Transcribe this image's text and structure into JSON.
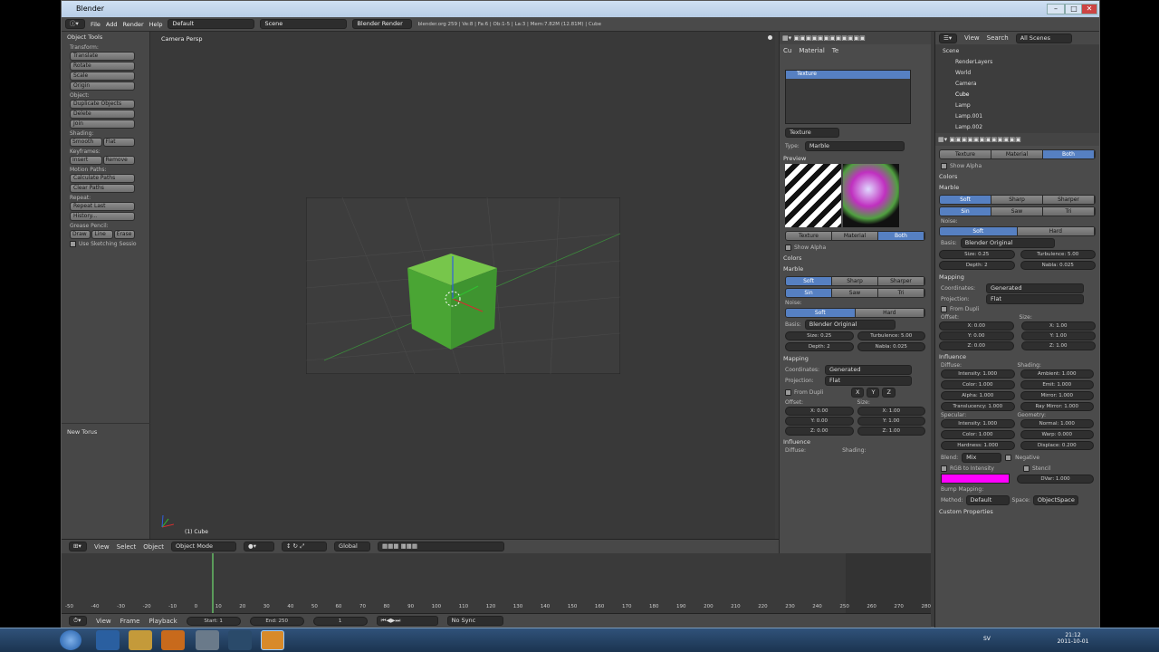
{
  "window": {
    "title": "Blender"
  },
  "menu": {
    "items": [
      "File",
      "Add",
      "Render",
      "Help"
    ],
    "layout": "Default",
    "scene": "Scene",
    "engine": "Blender Render",
    "stats": "blender.org 259 | Ve:8 | Fa:6 | Ob:1-5 | La:3 | Mem:7.82M (12.81M) | Cube"
  },
  "tools": {
    "header": "Object Tools",
    "transform_label": "Transform:",
    "transform": [
      "Translate",
      "Rotate",
      "Scale",
      "Origin"
    ],
    "object_label": "Object:",
    "object": [
      "Duplicate Objects",
      "Delete",
      "Join"
    ],
    "shading_label": "Shading:",
    "shading": [
      "Smooth",
      "Flat"
    ],
    "keyframes_label": "Keyframes:",
    "keyframes": [
      "Insert",
      "Remove"
    ],
    "motion_label": "Motion Paths:",
    "motion": [
      "Calculate Paths",
      "Clear Paths"
    ],
    "repeat_label": "Repeat:",
    "repeat": [
      "Repeat Last",
      "History..."
    ],
    "grease_label": "Grease Pencil:",
    "grease": [
      "Draw",
      "Line",
      "Erase"
    ],
    "sketch": "Use Sketching Sessio",
    "new_torus": "New Torus"
  },
  "viewport": {
    "label": "Camera Persp",
    "object_label": "(1) Cube"
  },
  "vheader": {
    "view": "View",
    "select": "Select",
    "object": "Object",
    "mode": "Object Mode",
    "orient": "Global"
  },
  "timeline": {
    "ticks": [
      "-50",
      "-40",
      "-30",
      "-20",
      "-10",
      "0",
      "10",
      "20",
      "30",
      "40",
      "50",
      "60",
      "70",
      "80",
      "90",
      "100",
      "110",
      "120",
      "130",
      "140",
      "150",
      "160",
      "170",
      "180",
      "190",
      "200",
      "210",
      "220",
      "230",
      "240",
      "250",
      "260",
      "270",
      "280"
    ],
    "view": "View",
    "frame": "Frame",
    "playback": "Playback",
    "start": "Start: 1",
    "end": "End: 250",
    "current": "1",
    "sync": "No Sync"
  },
  "tex": {
    "ctx": [
      "Cu",
      "Material",
      "Te"
    ],
    "slot": "Texture",
    "texname": "Texture",
    "type_label": "Type:",
    "type": "Marble",
    "preview": "Preview",
    "tabs": [
      "Texture",
      "Material",
      "Both"
    ],
    "show_alpha": "Show Alpha",
    "colors": "Colors",
    "marble": "Marble",
    "marble_t1": [
      "Soft",
      "Sharp",
      "Sharper"
    ],
    "marble_t2": [
      "Sin",
      "Saw",
      "Tri"
    ],
    "noise_label": "Noise:",
    "noise": [
      "Soft",
      "Hard"
    ],
    "basis_label": "Basis:",
    "basis": "Blender Original",
    "size": "Size: 0.25",
    "turb": "Turbulence: 5.00",
    "depth": "Depth: 2",
    "nabla": "Nabla: 0.025",
    "mapping": "Mapping",
    "coords_label": "Coordinates:",
    "coords": "Generated",
    "proj_label": "Projection:",
    "proj": "Flat",
    "from_dupli": "From Dupli",
    "xyz": [
      "X",
      "Y",
      "Z"
    ],
    "offset": "Offset:",
    "sizeh": "Size:",
    "offs": [
      "X: 0.00",
      "Y: 0.00",
      "Z: 0.00"
    ],
    "sizes": [
      "X: 1.00",
      "Y: 1.00",
      "Z: 1.00"
    ],
    "influence": "Influence",
    "diffuse": "Diffuse:",
    "shading": "Shading:"
  },
  "outliner": {
    "view": "View",
    "search": "Search",
    "scenes": "All Scenes",
    "items": [
      "Scene",
      "RenderLayers",
      "World",
      "Camera",
      "Cube",
      "Lamp",
      "Lamp.001",
      "Lamp.002"
    ]
  },
  "props": {
    "tabs": [
      "Texture",
      "Material",
      "Both"
    ],
    "show_alpha": "Show Alpha",
    "colors": "Colors",
    "marble": "Marble",
    "marble_t1": [
      "Soft",
      "Sharp",
      "Sharper"
    ],
    "marble_t2": [
      "Sin",
      "Saw",
      "Tri"
    ],
    "noise_label": "Noise:",
    "noise": [
      "Soft",
      "Hard"
    ],
    "basis_label": "Basis:",
    "basis": "Blender Original",
    "size": "Size: 0.25",
    "turb": "Turbulence: 5.00",
    "depth": "Depth: 2",
    "nabla": "Nabla: 0.025",
    "mapping": "Mapping",
    "coords_label": "Coordinates:",
    "coords": "Generated",
    "proj_label": "Projection:",
    "proj": "Flat",
    "from_dupli": "From Dupli",
    "offset": "Offset:",
    "sizeh": "Size:",
    "offs": [
      "X: 0.00",
      "Y: 0.00",
      "Z: 0.00"
    ],
    "sizes": [
      "X: 1.00",
      "Y: 1.00",
      "Z: 1.00"
    ],
    "influence": "Influence",
    "diffuse": "Diffuse:",
    "shading": "Shading:",
    "diff_items": [
      "Intensity: 1.000",
      "Color: 1.000",
      "Alpha: 1.000",
      "Translucency: 1.000"
    ],
    "shad_items": [
      "Ambient: 1.000",
      "Emit: 1.000",
      "Mirror: 1.000",
      "Ray Mirror: 1.000"
    ],
    "specular": "Specular:",
    "geometry": "Geometry:",
    "spec_items": [
      "Intensity: 1.000",
      "Color: 1.000",
      "Hardness: 1.000"
    ],
    "geo_items": [
      "Normal: 1.000",
      "Warp: 0.000",
      "Displace: 0.200"
    ],
    "blend_label": "Blend:",
    "blend": "Mix",
    "negative": "Negative",
    "rgb": "RGB to Intensity",
    "stencil": "Stencil",
    "dvar": "DVar: 1.000",
    "bump": "Bump Mapping:",
    "method_label": "Method:",
    "method": "Default",
    "space_label": "Space:",
    "space": "ObjectSpace",
    "custom": "Custom Properties",
    "swatch_color": "#ff00ff"
  },
  "taskbar": {
    "lang": "SV",
    "time": "21:12",
    "date": "2011-10-01"
  }
}
